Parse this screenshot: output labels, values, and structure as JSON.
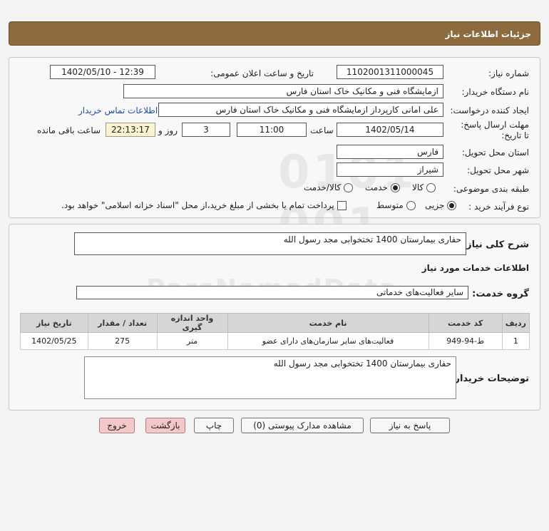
{
  "header": {
    "title": "جزئیات اطلاعات نیاز"
  },
  "form": {
    "need_number_label": "شماره نیاز:",
    "need_number": "1102001311000045",
    "announce_label": "تاریخ و ساعت اعلان عمومی:",
    "announce_value": "1402/05/10 - 12:39",
    "buyer_org_label": "نام دستگاه خریدار:",
    "buyer_org": "ازمایشگاه فنی و مکانیک خاک استان فارس",
    "requester_label": "ایجاد کننده درخواست:",
    "requester": "علی امانی کارپرداز ازمایشگاه فنی و مکانیک خاک استان فارس",
    "contact_link": "اطلاعات تماس خریدار",
    "deadline_label": "مهلت ارسال پاسخ: تا تاریخ:",
    "deadline_date": "1402/05/14",
    "time_label": "ساعت",
    "deadline_time": "11:00",
    "days_value": "3",
    "days_label": "روز و",
    "remaining_time": "22:13:17",
    "remaining_label": "ساعت باقی مانده",
    "province_label": "استان محل تحویل:",
    "province": "فارس",
    "city_label": "شهر محل تحویل:",
    "city": "شیراز",
    "category_label": "طبقه بندی موضوعی:",
    "category_options": [
      "کالا",
      "خدمت",
      "کالا/خدمت"
    ],
    "category_selected": "خدمت",
    "process_label": "نوع فرآیند خرید :",
    "process_options": [
      "جزیی",
      "متوسط"
    ],
    "process_selected": "جزیی",
    "payment_note": "پرداخت تمام یا بخشی از مبلغ خرید،از محل \"اسناد خزانه اسلامی\" خواهد بود."
  },
  "summary": {
    "general_label": "شرح کلی نیاز:",
    "general_value": "حفاری بیمارستان 1400 تختخوابی مجد رسول الله",
    "services_title": "اطلاعات خدمات مورد نیاز",
    "service_group_label": "گروه خدمت:",
    "service_group": "سایر فعالیت‌های خدماتی",
    "table": {
      "headers": [
        "ردیف",
        "کد خدمت",
        "نام خدمت",
        "واحد اندازه گیری",
        "تعداد / مقدار",
        "تاریخ نیاز"
      ],
      "rows": [
        [
          "1",
          "ط-94-949",
          "فعالیت‌های سایر سازمان‌های دارای عضو",
          "متر",
          "275",
          "1402/05/25"
        ]
      ]
    },
    "buyer_notes_label": "توضیحات خریدار:",
    "buyer_notes": "حفاری بیمارستان 1400 تختخوابی مجد رسول الله"
  },
  "buttons": {
    "reply": "پاسخ به نیاز",
    "attachments": "مشاهده مدارک پیوستی (0)",
    "print": "چاپ",
    "back": "بازگشت",
    "exit": "خروج"
  },
  "colors": {
    "header_bg": "#8d6b3f",
    "link": "#1f4fae",
    "pink_button": "#f4c8c8",
    "remaining_bg": "#fbf4cf"
  }
}
